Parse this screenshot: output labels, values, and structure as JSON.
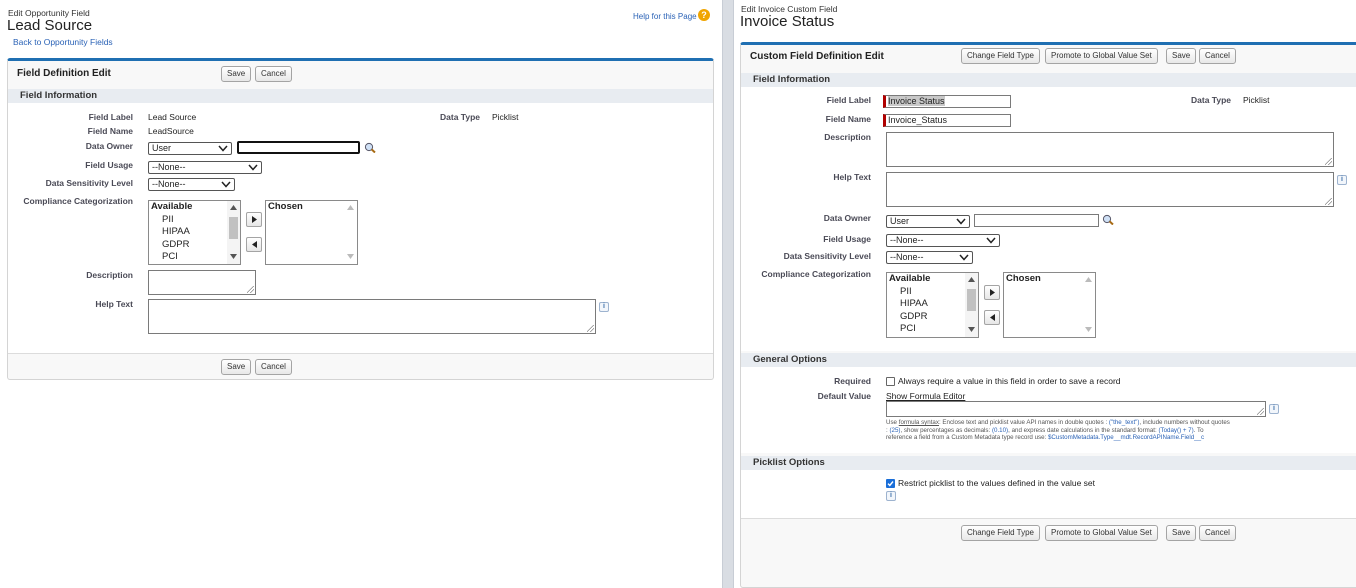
{
  "left": {
    "breadcrumb": "Edit Opportunity Field",
    "title": "Lead Source",
    "back_link": "Back to Opportunity Fields",
    "help_link": "Help for this Page",
    "panel_title": "Field Definition Edit",
    "save_label": "Save",
    "cancel_label": "Cancel",
    "section_field_info": "Field Information",
    "field_label_label": "Field Label",
    "field_label_value": "Lead Source",
    "field_name_label": "Field Name",
    "field_name_value": "LeadSource",
    "data_type_label": "Data Type",
    "data_type_value": "Picklist",
    "data_owner_label": "Data Owner",
    "data_owner_value": "User",
    "field_usage_label": "Field Usage",
    "field_usage_value": "--None--",
    "sensitivity_label": "Data Sensitivity Level",
    "sensitivity_value": "--None--",
    "compliance_label": "Compliance Categorization",
    "available_header": "Available",
    "available_options": [
      "PII",
      "HIPAA",
      "GDPR",
      "PCI"
    ],
    "chosen_header": "Chosen",
    "description_label": "Description",
    "help_text_label": "Help Text"
  },
  "right": {
    "breadcrumb": "Edit Invoice Custom Field",
    "title": "Invoice Status",
    "panel_title": "Custom Field Definition Edit",
    "change_type_label": "Change Field Type",
    "promote_label": "Promote to Global Value Set",
    "save_label": "Save",
    "cancel_label": "Cancel",
    "section_field_info": "Field Information",
    "field_label_label": "Field Label",
    "field_label_value": "Invoice Status",
    "field_name_label": "Field Name",
    "field_name_value": "Invoice_Status",
    "data_type_label": "Data Type",
    "data_type_value": "Picklist",
    "description_label": "Description",
    "help_text_label": "Help Text",
    "data_owner_label": "Data Owner",
    "data_owner_value": "User",
    "field_usage_label": "Field Usage",
    "field_usage_value": "--None--",
    "sensitivity_label": "Data Sensitivity Level",
    "sensitivity_value": "--None--",
    "compliance_label": "Compliance Categorization",
    "available_header": "Available",
    "available_options": [
      "PII",
      "HIPAA",
      "GDPR",
      "PCI"
    ],
    "chosen_header": "Chosen",
    "section_general": "General Options",
    "required_label": "Required",
    "required_text": "Always require a value in this field in order to save a record",
    "default_value_label": "Default Value",
    "show_formula_editor": "Show Formula Editor",
    "hint_line1_a": "Use ",
    "hint_formula_syntax": "formula syntax",
    "hint_line1_b": ": Enclose text and picklist value API names in double quotes : ",
    "hint_code1": "(\"the_text\")",
    "hint_line1_c": ", include numbers without quotes",
    "hint_line2_a": ": ",
    "hint_code2": "(25)",
    "hint_line2_b": ", show percentages as decimals: ",
    "hint_code3": "(0.10)",
    "hint_line2_c": ", and express date calculations in the standard format: ",
    "hint_code4": "(Today() + 7)",
    "hint_line2_d": ". To",
    "hint_line3_a": "reference a field from a Custom Metadata type record use: ",
    "hint_code5": "$CustomMetadata.Type__mdt.RecordAPIName.Field__c",
    "section_picklist": "Picklist Options",
    "restrict_text": "Restrict picklist to the values defined in the value set"
  },
  "colors": {
    "panel_border_top": "#1f6fb2",
    "section_bg": "#e8ecf1",
    "link": "#2a62b6",
    "divider": "#c8cdd5",
    "help_icon": "#f0a500"
  }
}
